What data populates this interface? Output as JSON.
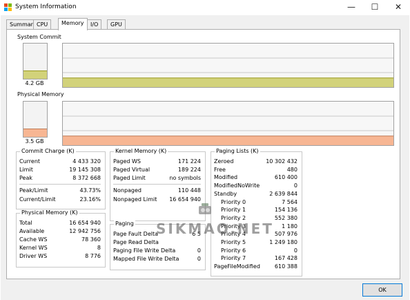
{
  "window": {
    "title": "System Information",
    "minimize_glyph": "—",
    "maximize_glyph": "☐",
    "close_glyph": "✕",
    "icon": "windows-flag-icon"
  },
  "tabs": [
    {
      "label": "Summary"
    },
    {
      "label": "CPU"
    },
    {
      "label": "Memory"
    },
    {
      "label": "I/O"
    },
    {
      "label": "GPU"
    }
  ],
  "active_tab": "Memory",
  "system_commit": {
    "label": "System Commit",
    "value": "4.2 GB",
    "gauge_fraction": 0.21,
    "color": "#d2d27a",
    "line_color": "#9a9a1e"
  },
  "physical_memory_gauge": {
    "label": "Physical Memory",
    "value": "3.5 GB",
    "gauge_fraction": 0.21,
    "color": "#f7b693",
    "line_color": "#c07a55"
  },
  "commit_charge": {
    "title": "Commit Charge (K)",
    "rows": [
      {
        "label": "Current",
        "value": "4 433 320"
      },
      {
        "label": "Limit",
        "value": "19 145 308"
      },
      {
        "label": "Peak",
        "value": "8 372 668"
      }
    ],
    "rows2": [
      {
        "label": "Peak/Limit",
        "value": "43.73%"
      },
      {
        "label": "Current/Limit",
        "value": "23.16%"
      }
    ]
  },
  "physical_memory": {
    "title": "Physical Memory (K)",
    "rows": [
      {
        "label": "Total",
        "value": "16 654 940"
      },
      {
        "label": "Available",
        "value": "12 942 756"
      },
      {
        "label": "Cache WS",
        "value": "78 360"
      },
      {
        "label": "Kernel WS",
        "value": "8"
      },
      {
        "label": "Driver WS",
        "value": "8 776"
      }
    ]
  },
  "kernel_memory": {
    "title": "Kernel Memory (K)",
    "rows": [
      {
        "label": "Paged WS",
        "value": "171 224"
      },
      {
        "label": "Paged Virtual",
        "value": "189 224"
      },
      {
        "label": "Paged Limit",
        "value": "no symbols"
      }
    ],
    "rows2": [
      {
        "label": "Nonpaged",
        "value": "110 448"
      },
      {
        "label": "Nonpaged Limit",
        "value": "16 654 940"
      }
    ]
  },
  "paging": {
    "title": "Paging",
    "rows": [
      {
        "label": "Page Fault Delta",
        "value": "6 5"
      },
      {
        "label": "Page Read Delta",
        "value": ""
      },
      {
        "label": "Paging File Write Delta",
        "value": "0"
      },
      {
        "label": "Mapped File Write Delta",
        "value": "0"
      }
    ]
  },
  "paging_lists": {
    "title": "Paging Lists (K)",
    "rows": [
      {
        "label": "Zeroed",
        "value": "10 302 432",
        "indent": false
      },
      {
        "label": "Free",
        "value": "480",
        "indent": false
      },
      {
        "label": "Modified",
        "value": "610 400",
        "indent": false
      },
      {
        "label": "ModifiedNoWrite",
        "value": "0",
        "indent": false
      },
      {
        "label": "Standby",
        "value": "2 639 844",
        "indent": false
      },
      {
        "label": "Priority 0",
        "value": "7 564",
        "indent": true
      },
      {
        "label": "Priority 1",
        "value": "154 136",
        "indent": true
      },
      {
        "label": "Priority 2",
        "value": "552 380",
        "indent": true
      },
      {
        "label": "Priority 3",
        "value": "1 180",
        "indent": true
      },
      {
        "label": "Priority 4",
        "value": "507 976",
        "indent": true
      },
      {
        "label": "Priority 5",
        "value": "1 249 180",
        "indent": true
      },
      {
        "label": "Priority 6",
        "value": "0",
        "indent": true
      },
      {
        "label": "Priority 7",
        "value": "167 428",
        "indent": true
      },
      {
        "label": "PageFileModified",
        "value": "610 388",
        "indent": false
      }
    ]
  },
  "ok_button": {
    "label": "OK"
  },
  "watermark": {
    "text": "SIKMAO.NET"
  }
}
